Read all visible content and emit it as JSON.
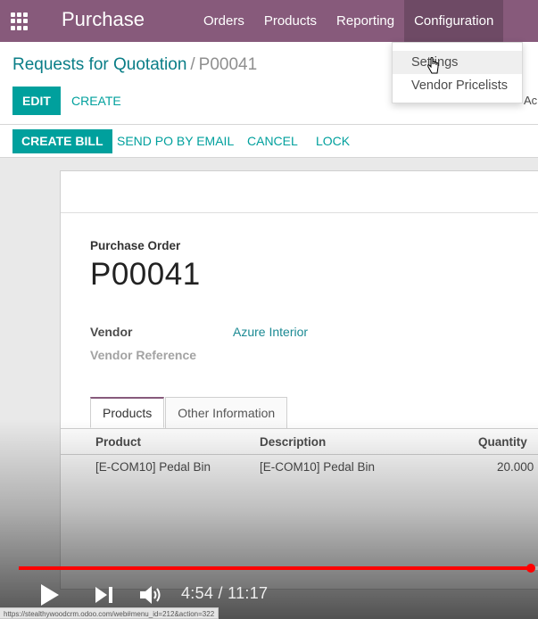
{
  "navbar": {
    "brand": "Purchase",
    "menus": [
      "Orders",
      "Products",
      "Reporting",
      "Configuration"
    ],
    "active_menu_index": 3
  },
  "dropdown": {
    "items": [
      "Settings",
      "Vendor Pricelists"
    ],
    "hovered_index": 0
  },
  "breadcrumb": {
    "parent": "Requests for Quotation",
    "separator": "/",
    "current": "P00041"
  },
  "control_panel": {
    "edit_label": "EDIT",
    "create_label": "CREATE",
    "partial_text": "Ac"
  },
  "statusbar": {
    "create_bill_label": "CREATE BILL",
    "send_po_label": "SEND PO BY EMAIL",
    "cancel_label": "CANCEL",
    "lock_label": "LOCK"
  },
  "form": {
    "title_label": "Purchase Order",
    "name": "P00041",
    "vendor_label": "Vendor",
    "vendor_value": "Azure Interior",
    "vendor_ref_label": "Vendor Reference"
  },
  "tabs": [
    "Products",
    "Other Information"
  ],
  "active_tab_index": 0,
  "table": {
    "headers": [
      "Product",
      "Description",
      "Quantity"
    ],
    "rows": [
      [
        "[E-COM10] Pedal Bin",
        "[E-COM10] Pedal Bin",
        "20.000"
      ]
    ]
  },
  "video": {
    "time_display": "4:54 / 11:17",
    "progress_fraction": 0.987,
    "icons": [
      "play-icon",
      "next-icon",
      "volume-icon"
    ]
  },
  "status_url": "https://stealthywoodcrm.odoo.com/web#menu_id=212&action=322",
  "colors": {
    "navbar": "#875a7b",
    "primary": "#00a09d",
    "link": "#1b8a93",
    "progress": "#ff0000"
  }
}
